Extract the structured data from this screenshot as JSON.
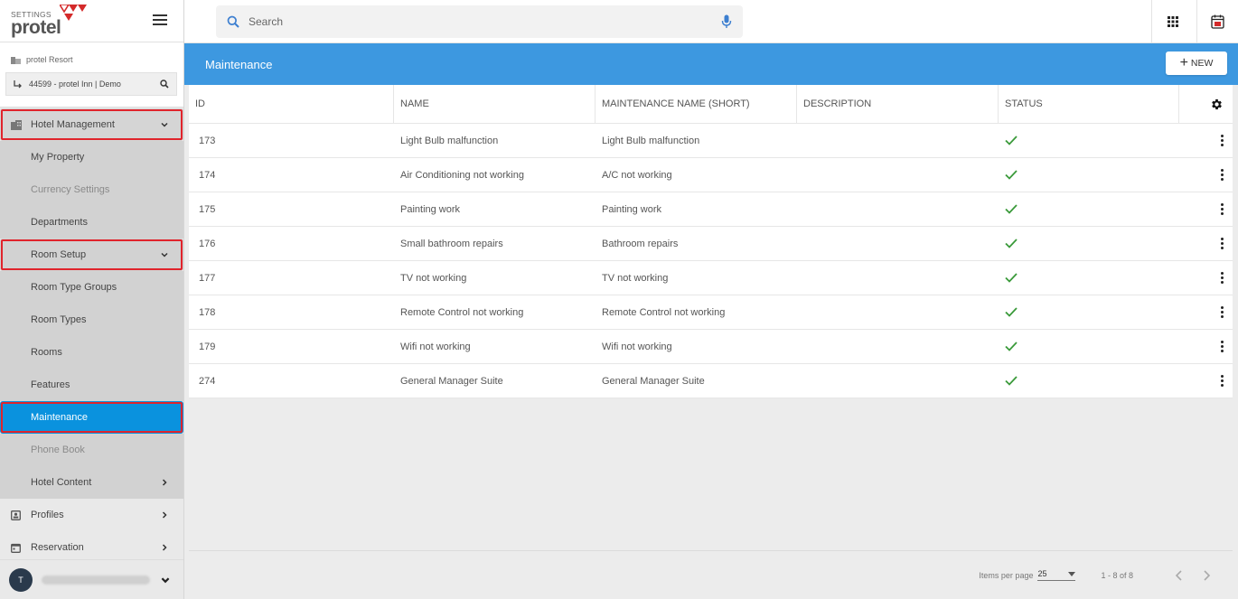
{
  "app": {
    "section_label": "SETTINGS",
    "brand": "protel"
  },
  "property": {
    "resort": "protel Resort",
    "picker": "44599 - protel Inn | Demo"
  },
  "nav": {
    "hotel_management": "Hotel Management",
    "my_property": "My Property",
    "currency_settings": "Currency Settings",
    "departments": "Departments",
    "room_setup": "Room Setup",
    "room_type_groups": "Room Type Groups",
    "room_types": "Room Types",
    "rooms": "Rooms",
    "features": "Features",
    "maintenance": "Maintenance",
    "phone_book": "Phone Book",
    "hotel_content": "Hotel Content",
    "profiles": "Profiles",
    "reservation": "Reservation"
  },
  "user": {
    "initial": "T"
  },
  "search": {
    "placeholder": "Search"
  },
  "header": {
    "title": "Maintenance",
    "new_label": "NEW"
  },
  "table": {
    "columns": [
      "ID",
      "NAME",
      "MAINTENANCE NAME (SHORT)",
      "DESCRIPTION",
      "STATUS"
    ],
    "rows": [
      {
        "id": "173",
        "name": "Light Bulb malfunction",
        "short": "Light Bulb malfunction",
        "description": ""
      },
      {
        "id": "174",
        "name": "Air Conditioning not working",
        "short": "A/C not working",
        "description": ""
      },
      {
        "id": "175",
        "name": "Painting work",
        "short": "Painting work",
        "description": ""
      },
      {
        "id": "176",
        "name": "Small bathroom repairs",
        "short": "Bathroom repairs",
        "description": ""
      },
      {
        "id": "177",
        "name": "TV not working",
        "short": "TV not working",
        "description": ""
      },
      {
        "id": "178",
        "name": "Remote Control not working",
        "short": "Remote Control not working",
        "description": ""
      },
      {
        "id": "179",
        "name": "Wifi not working",
        "short": "Wifi not working",
        "description": ""
      },
      {
        "id": "274",
        "name": "General Manager Suite",
        "short": "General Manager Suite",
        "description": ""
      }
    ]
  },
  "pagination": {
    "items_per_page_label": "Items per page",
    "items_per_page": "25",
    "range": "1 - 8 of 8"
  },
  "colors": {
    "accent": "#3d98e0",
    "active": "#0a92de",
    "highlight": "#e0242c",
    "check": "#3a9a3a"
  }
}
